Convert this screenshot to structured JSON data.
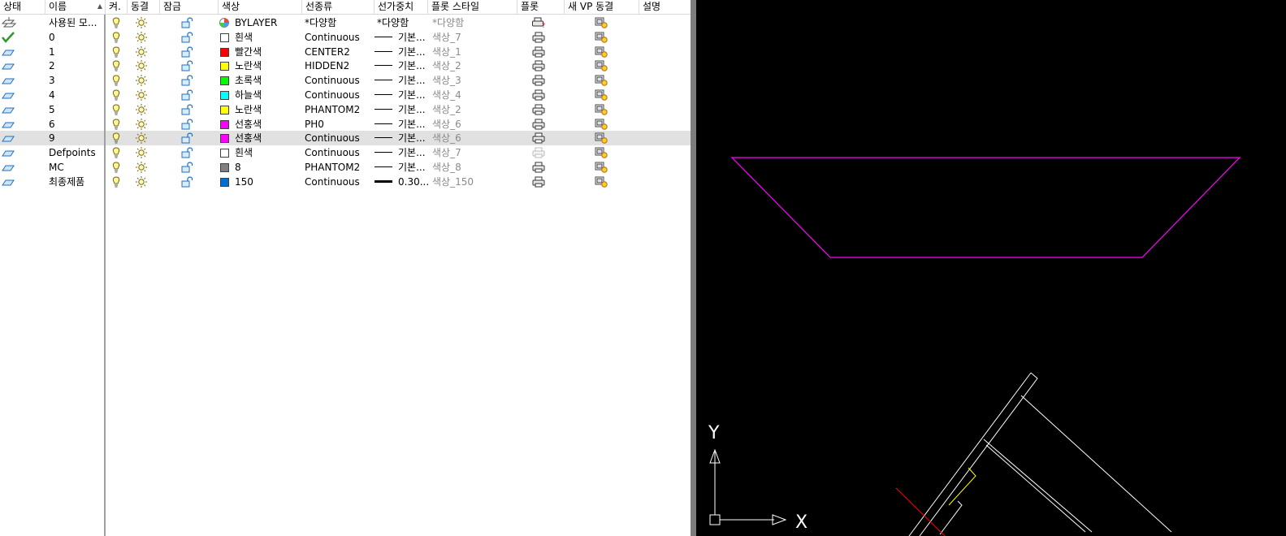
{
  "header": {
    "status": "상태",
    "name": "이름",
    "on": "켜.",
    "freeze": "동결",
    "lock": "잠금",
    "color": "색상",
    "linetype": "선종류",
    "lineweight": "선가중치",
    "plotstyle": "플롯 스타일",
    "plot": "플롯",
    "vp_freeze": "새 VP 동결",
    "description": "설명"
  },
  "layers": [
    {
      "status": "all-used-icon",
      "name": "사용된 모...",
      "color_name": "BYLAYER",
      "color_hex": "bylayer",
      "linetype": "*다양함",
      "lineweight": "*다양함",
      "lw_thick": false,
      "lw_varies": true,
      "plotstyle": "*다양함",
      "plot": "varies",
      "selected": false
    },
    {
      "status": "current",
      "name": "0",
      "color_name": "흰색",
      "color_hex": "#ffffff",
      "linetype": "Continuous",
      "lineweight": "기본...",
      "lw_thick": false,
      "lw_varies": false,
      "plotstyle": "색상_7",
      "plot": "on",
      "selected": false
    },
    {
      "status": "layer",
      "name": "1",
      "color_name": "빨간색",
      "color_hex": "#ff0000",
      "linetype": "CENTER2",
      "lineweight": "기본...",
      "lw_thick": false,
      "lw_varies": false,
      "plotstyle": "색상_1",
      "plot": "on",
      "selected": false
    },
    {
      "status": "layer",
      "name": "2",
      "color_name": "노란색",
      "color_hex": "#ffff00",
      "linetype": "HIDDEN2",
      "lineweight": "기본...",
      "lw_thick": false,
      "lw_varies": false,
      "plotstyle": "색상_2",
      "plot": "on",
      "selected": false
    },
    {
      "status": "layer",
      "name": "3",
      "color_name": "초록색",
      "color_hex": "#00ff00",
      "linetype": "Continuous",
      "lineweight": "기본...",
      "lw_thick": false,
      "lw_varies": false,
      "plotstyle": "색상_3",
      "plot": "on",
      "selected": false
    },
    {
      "status": "layer",
      "name": "4",
      "color_name": "하늘색",
      "color_hex": "#00ffff",
      "linetype": "Continuous",
      "lineweight": "기본...",
      "lw_thick": false,
      "lw_varies": false,
      "plotstyle": "색상_4",
      "plot": "on",
      "selected": false
    },
    {
      "status": "layer",
      "name": "5",
      "color_name": "노란색",
      "color_hex": "#ffff00",
      "linetype": "PHANTOM2",
      "lineweight": "기본...",
      "lw_thick": false,
      "lw_varies": false,
      "plotstyle": "색상_2",
      "plot": "on",
      "selected": false
    },
    {
      "status": "layer",
      "name": "6",
      "color_name": "선홍색",
      "color_hex": "#ff00ff",
      "linetype": "PH0",
      "lineweight": "기본...",
      "lw_thick": false,
      "lw_varies": false,
      "plotstyle": "색상_6",
      "plot": "on",
      "selected": false
    },
    {
      "status": "layer",
      "name": "9",
      "color_name": "선홍색",
      "color_hex": "#ff00ff",
      "linetype": "Continuous",
      "lineweight": "기본...",
      "lw_thick": false,
      "lw_varies": false,
      "plotstyle": "색상_6",
      "plot": "on",
      "selected": true
    },
    {
      "status": "layer",
      "name": "Defpoints",
      "color_name": "흰색",
      "color_hex": "#ffffff",
      "linetype": "Continuous",
      "lineweight": "기본...",
      "lw_thick": false,
      "lw_varies": false,
      "plotstyle": "색상_7",
      "plot": "off",
      "selected": false
    },
    {
      "status": "layer",
      "name": "MC",
      "color_name": "8",
      "color_hex": "#808080",
      "linetype": "PHANTOM2",
      "lineweight": "기본...",
      "lw_thick": false,
      "lw_varies": false,
      "plotstyle": "색상_8",
      "plot": "on",
      "selected": false
    },
    {
      "status": "layer",
      "name": "최종제품",
      "color_name": "150",
      "color_hex": "#0070d0",
      "linetype": "Continuous",
      "lineweight": "0.30...",
      "lw_thick": true,
      "lw_varies": false,
      "plotstyle": "색상_150",
      "plot": "on",
      "selected": false
    }
  ],
  "viewport": {
    "background": "#000000",
    "ucs_x_label": "X",
    "ucs_y_label": "Y",
    "colors": {
      "magenta": "#ff00ff",
      "white": "#ffffff",
      "yellow": "#ffff00",
      "red": "#ff0000"
    }
  }
}
